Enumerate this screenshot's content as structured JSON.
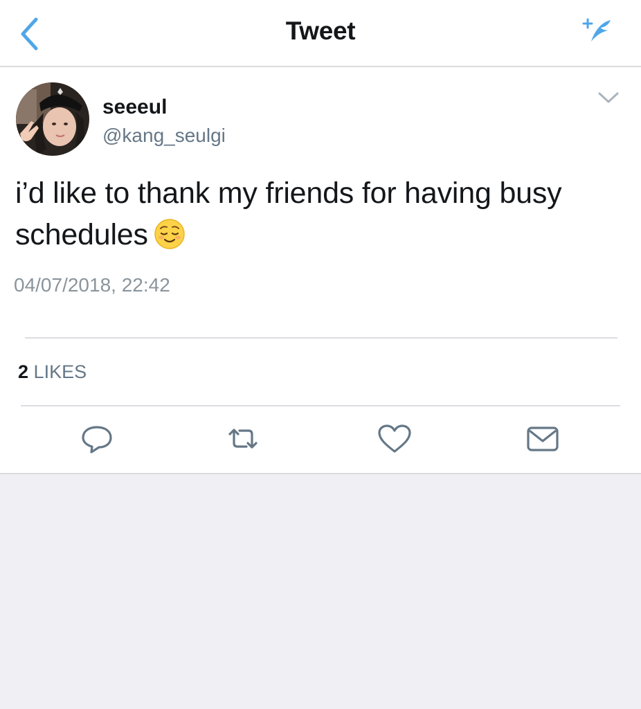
{
  "nav": {
    "title": "Tweet",
    "back_icon": "chevron-left-icon",
    "compose_icon": "compose-tweet-icon",
    "accent_color": "#1da1f2"
  },
  "tweet": {
    "author": {
      "display_name": "seeeul",
      "handle": "@kang_seulgi"
    },
    "text": "i’d like to thank my friends for having busy schedules",
    "emoji": "relieved-face-emoji",
    "timestamp": "04/07/2018, 22:42",
    "likes": {
      "count": "2",
      "label": "LIKES"
    },
    "actions": [
      "reply-icon",
      "retweet-icon",
      "like-icon",
      "direct-message-icon"
    ]
  },
  "colors": {
    "text_primary": "#14171a",
    "text_secondary": "#657786",
    "page_background": "#f0eff4",
    "divider": "#dcdde2"
  }
}
